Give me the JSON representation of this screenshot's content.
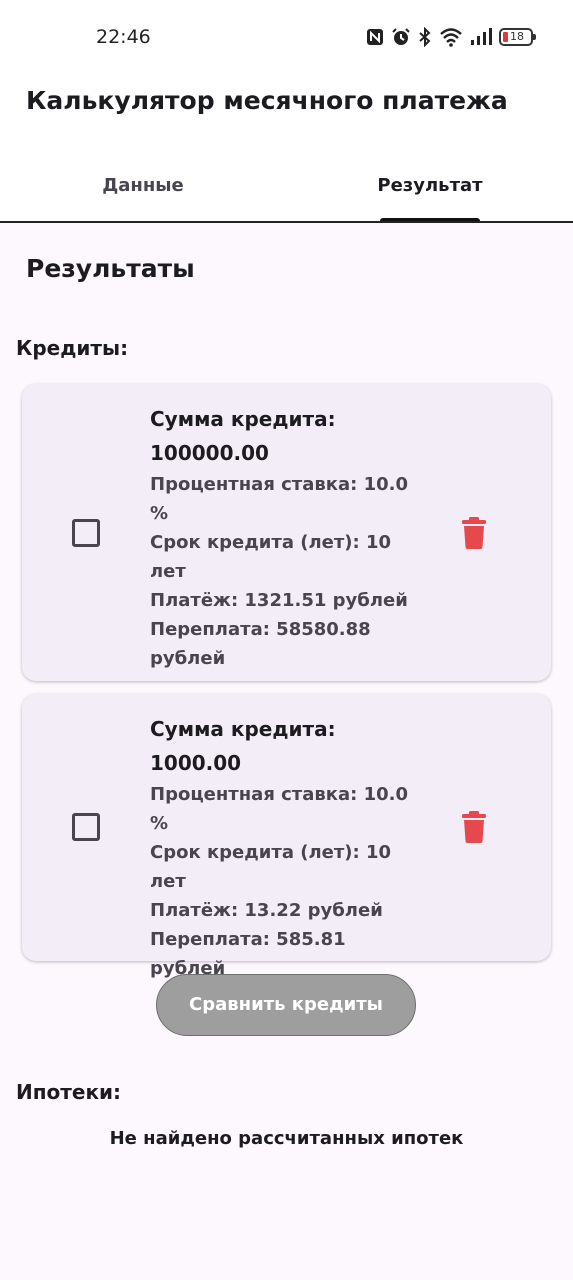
{
  "status_bar": {
    "time": "22:46",
    "battery_level": "18",
    "icons": [
      "nfc-icon",
      "alarm-icon",
      "bluetooth-icon",
      "wifi-icon",
      "signal-icon",
      "battery-icon"
    ]
  },
  "app_bar": {
    "title": "Калькулятор месячного платежа"
  },
  "tabs": [
    {
      "label": "Данные",
      "selected": false
    },
    {
      "label": "Результат",
      "selected": true
    }
  ],
  "results": {
    "title": "Результаты",
    "credits_label": "Кредиты:",
    "credits": [
      {
        "amount_label": "Сумма кредита:",
        "amount": "100000.00",
        "rate": "Процентная ставка: 10.0 %",
        "term": "Срок кредита (лет): 10 лет",
        "payment": "Платёж: 1321.51 рублей",
        "overpayment": "Переплата: 58580.88 рублей",
        "checked": false
      },
      {
        "amount_label": "Сумма кредита:",
        "amount": "1000.00",
        "rate": "Процентная ставка: 10.0 %",
        "term": "Срок кредита (лет): 10 лет",
        "payment": "Платёж: 13.22 рублей",
        "overpayment": "Переплата: 585.81 рублей",
        "checked": false
      }
    ],
    "compare_button": "Сравнить кредиты",
    "mortgages_label": "Ипотеки:",
    "mortgages_empty": "Не найдено рассчитанных ипотек"
  },
  "colors": {
    "background": "#fdf7fe",
    "card": "#f3edf7",
    "delete": "#e5484d",
    "button_disabled": "#9e9e9e",
    "tab_indicator": "#111111"
  }
}
